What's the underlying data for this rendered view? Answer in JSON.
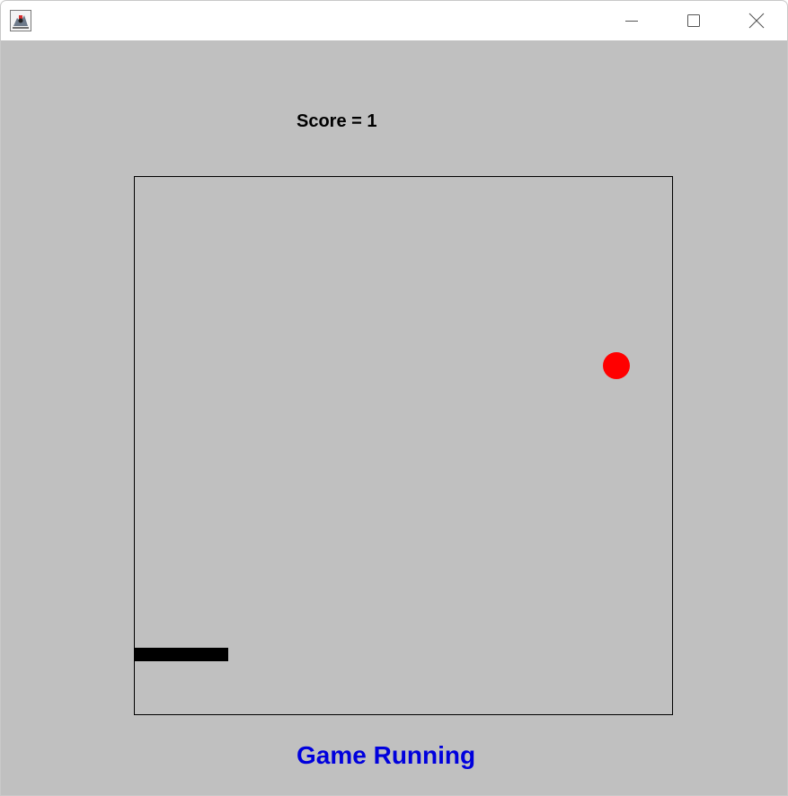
{
  "window": {
    "app_icon": "java-duke-icon",
    "controls": {
      "minimize_icon": "minimize-icon",
      "maximize_icon": "maximize-icon",
      "close_icon": "close-icon"
    }
  },
  "game": {
    "score_text": "Score = 1",
    "status_text": "Game Running",
    "colors": {
      "background": "#c0c0c0",
      "ball": "#ff0000",
      "paddle": "#000000",
      "status": "#0000dd",
      "border": "#000000"
    }
  }
}
